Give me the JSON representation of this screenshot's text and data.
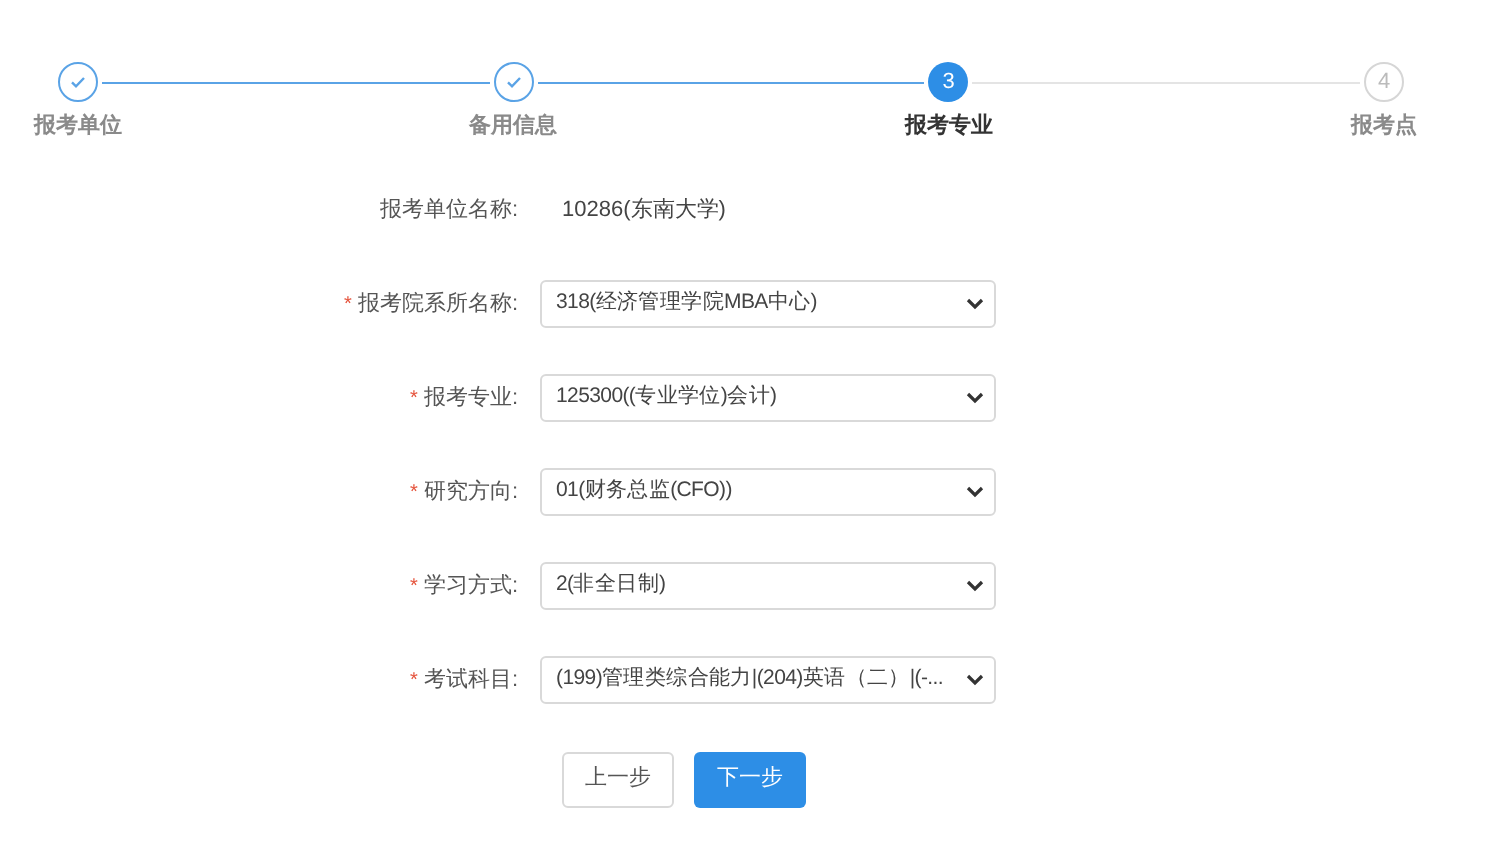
{
  "steps": [
    {
      "label": "报考单位",
      "done": true,
      "selected": false
    },
    {
      "label": "备用信息",
      "done": true,
      "selected": false
    },
    {
      "number": "3",
      "label": "报考专业",
      "done": false,
      "selected": true
    },
    {
      "number": "4",
      "label": "报考点",
      "done": false,
      "selected": false
    }
  ],
  "fields": [
    {
      "kind": "text",
      "label": "报考单位名称:",
      "value": "10286(东南大学)"
    },
    {
      "kind": "select",
      "required_mark": "*",
      "label": "报考院系所名称:",
      "value": "318(经济管理学院MBA中心)"
    },
    {
      "kind": "select",
      "required_mark": "*",
      "label": "报考专业:",
      "value": "125300((专业学位)会计)"
    },
    {
      "kind": "select",
      "required_mark": "*",
      "label": "研究方向:",
      "value": "01(财务总监(CFO))"
    },
    {
      "kind": "select",
      "required_mark": "*",
      "label": "学习方式:",
      "value": "2(非全日制)"
    },
    {
      "kind": "select",
      "required_mark": "*",
      "label": "考试科目:",
      "value": "(199)管理类综合能力|(204)英语（二）|(-..."
    }
  ],
  "buttons": [
    {
      "label": "上一步",
      "kind": "secondary"
    },
    {
      "label": "下一步",
      "kind": "primary"
    }
  ]
}
